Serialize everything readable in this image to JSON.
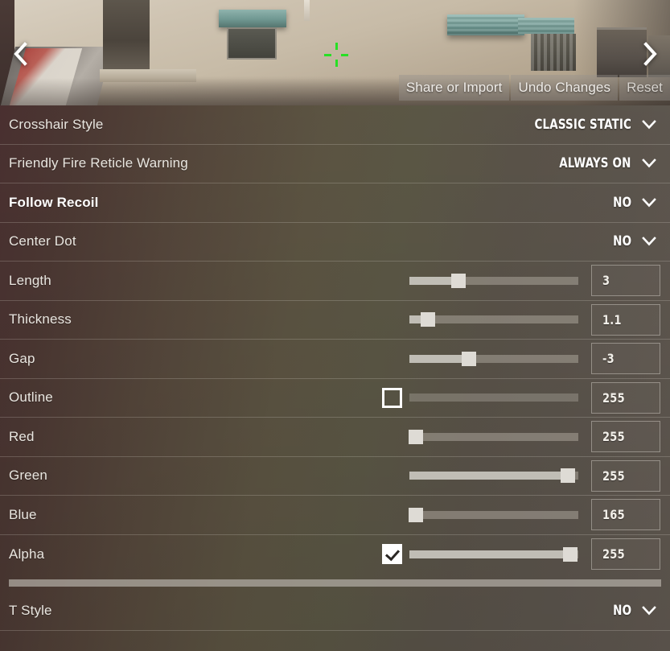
{
  "preview": {
    "nav_prev_icon": "chevron-left-icon",
    "nav_next_icon": "chevron-right-icon",
    "crosshair_color": "#27e025",
    "buttons": [
      {
        "label": "Share or Import",
        "name": "share-or-import-button"
      },
      {
        "label": "Undo Changes",
        "name": "undo-changes-button"
      },
      {
        "label": "Reset",
        "name": "reset-button"
      }
    ]
  },
  "settings": {
    "rows": [
      {
        "id": "crosshair-style",
        "label": "Crosshair Style",
        "type": "dropdown",
        "value": "CLASSIC STATIC",
        "active": false
      },
      {
        "id": "friendly-fire-reticle-warning",
        "label": "Friendly Fire Reticle Warning",
        "type": "dropdown",
        "value": "ALWAYS ON",
        "active": false
      },
      {
        "id": "follow-recoil",
        "label": "Follow Recoil",
        "type": "dropdown",
        "value": "NO",
        "active": true
      },
      {
        "id": "center-dot",
        "label": "Center Dot",
        "type": "dropdown",
        "value": "NO",
        "active": false
      },
      {
        "id": "length",
        "label": "Length",
        "type": "slider",
        "value": "3",
        "slider_percent": 29,
        "checkbox": null,
        "disabled": false,
        "active": false
      },
      {
        "id": "thickness",
        "label": "Thickness",
        "type": "slider",
        "value": "1.1",
        "slider_percent": 11,
        "checkbox": null,
        "disabled": false,
        "active": false
      },
      {
        "id": "gap",
        "label": "Gap",
        "type": "slider",
        "value": "-3",
        "slider_percent": 35,
        "checkbox": null,
        "disabled": false,
        "active": false
      },
      {
        "id": "outline",
        "label": "Outline",
        "type": "slider",
        "value": "255",
        "slider_percent": 0,
        "checkbox": "unchecked",
        "disabled": true,
        "active": false
      },
      {
        "id": "red",
        "label": "Red",
        "type": "slider",
        "value": "255",
        "slider_percent": 4,
        "checkbox": null,
        "disabled": false,
        "active": false
      },
      {
        "id": "green",
        "label": "Green",
        "type": "slider",
        "value": "255",
        "slider_percent": 94,
        "checkbox": null,
        "disabled": false,
        "active": false
      },
      {
        "id": "blue",
        "label": "Blue",
        "type": "slider",
        "value": "165",
        "slider_percent": 4,
        "checkbox": null,
        "disabled": false,
        "active": false
      },
      {
        "id": "alpha",
        "label": "Alpha",
        "type": "slider",
        "value": "255",
        "slider_percent": 95,
        "checkbox": "checked",
        "disabled": false,
        "active": false
      },
      {
        "id": "t-style",
        "label": "T Style",
        "type": "dropdown",
        "value": "NO",
        "active": false
      }
    ],
    "scrollbar_after_row_id": "alpha"
  }
}
